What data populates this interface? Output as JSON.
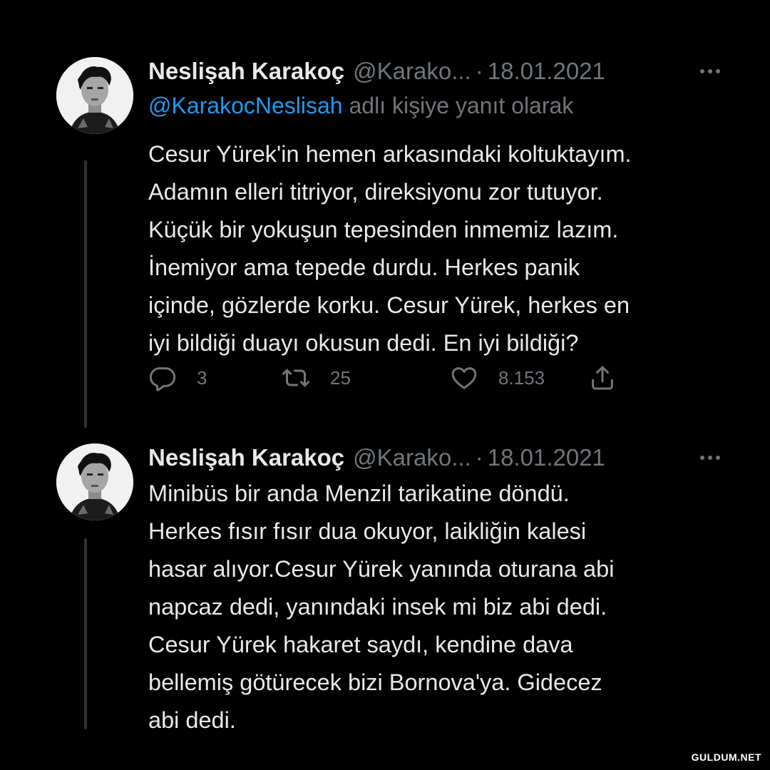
{
  "tweets": [
    {
      "display_name": "Neslişah Karakoç",
      "handle": "@Karako...",
      "separator": "·",
      "date": "18.01.2021",
      "reply_to": {
        "mention": "@KarakocNeslisah",
        "suffix": "adlı kişiye yanıt olarak"
      },
      "lines": [
        "Cesur Yürek'in hemen arkasındaki koltuktayım.",
        "Adamın elleri titriyor, direksiyonu zor tutuyor.",
        "Küçük bir yokuşun tepesinden inmemiz lazım.",
        "İnemiyor ama tepede durdu. Herkes panik",
        "içinde, gözlerde korku. Cesur Yürek, herkes en",
        "iyi bildiği duayı okusun dedi. En iyi bildiği?"
      ],
      "actions": {
        "reply_count": "3",
        "retweet_count": "25",
        "like_count": "8.153"
      },
      "icons": [
        "avatar",
        "more-icon",
        "reply-icon",
        "retweet-icon",
        "like-icon",
        "share-icon"
      ]
    },
    {
      "display_name": "Neslişah Karakoç",
      "handle": "@Karako...",
      "separator": "·",
      "date": "18.01.2021",
      "lines": [
        "Minibüs bir anda Menzil tarikatine döndü.",
        "Herkes fısır fısır dua okuyor, laikliğin kalesi",
        "hasar alıyor.Cesur Yürek yanında oturana abi",
        "napcaz dedi, yanındaki insek mi biz abi dedi.",
        "Cesur Yürek hakaret saydı, kendine dava",
        "bellemiş götürecek bizi Bornova'ya. Gidecez",
        "abi dedi."
      ],
      "icons": [
        "avatar",
        "more-icon"
      ]
    }
  ],
  "watermark": "GULDUM.NET",
  "colors": {
    "background": "#000000",
    "text": "#e7e9ea",
    "secondary": "#71767b",
    "mention": "#1d9bf0",
    "thread_line": "#2f3336"
  }
}
